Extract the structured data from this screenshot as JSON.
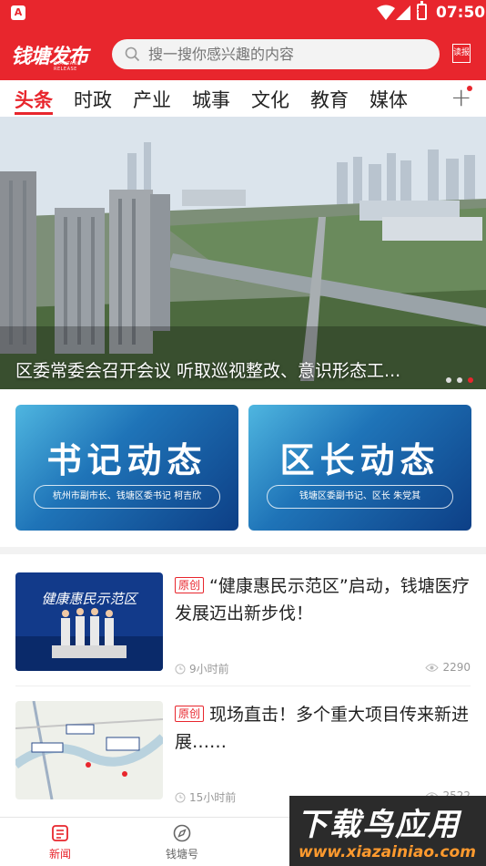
{
  "status_bar": {
    "time": "07:50",
    "app_badge": "A"
  },
  "header": {
    "logo_text": "钱塘发布",
    "logo_sub": "QIANTANG RELEASE",
    "search_placeholder": "搜一搜你感兴趣的内容",
    "read_paper_label": "读报"
  },
  "tabs": [
    {
      "label": "头条",
      "active": true
    },
    {
      "label": "时政"
    },
    {
      "label": "产业"
    },
    {
      "label": "城事"
    },
    {
      "label": "文化"
    },
    {
      "label": "教育"
    },
    {
      "label": "媒体"
    }
  ],
  "banner": {
    "caption": "区委常委会召开会议  听取巡视整改、意识形态工...",
    "dots_count": 3,
    "active_dot_index": 2
  },
  "cards": [
    {
      "title": "书记动态",
      "subtitle": "杭州市副市长、钱塘区委书记  柯吉欣"
    },
    {
      "title": "区长动态",
      "subtitle": "钱塘区委副书记、区长  朱党其"
    }
  ],
  "news": [
    {
      "tag": "原创",
      "title": "“健康惠民示范区”启动，钱塘医疗发展迈出新步伐！",
      "time": "9小时前",
      "views": "2290",
      "thumb_text": "健康惠民示范区"
    },
    {
      "tag": "原创",
      "title": "现场直击！多个重大项目传来新进展……",
      "time": "15小时前",
      "views": "2522"
    }
  ],
  "bottom_nav": [
    {
      "label": "新闻",
      "icon": "newspaper-icon",
      "active": true
    },
    {
      "label": "钱塘号",
      "icon": "compass-icon"
    }
  ],
  "watermark": {
    "main": "下载鸟应用",
    "url": "www.xiazainiao.com"
  },
  "colors": {
    "brand_red": "#e8262d",
    "card_blue": "#1f74b8"
  }
}
